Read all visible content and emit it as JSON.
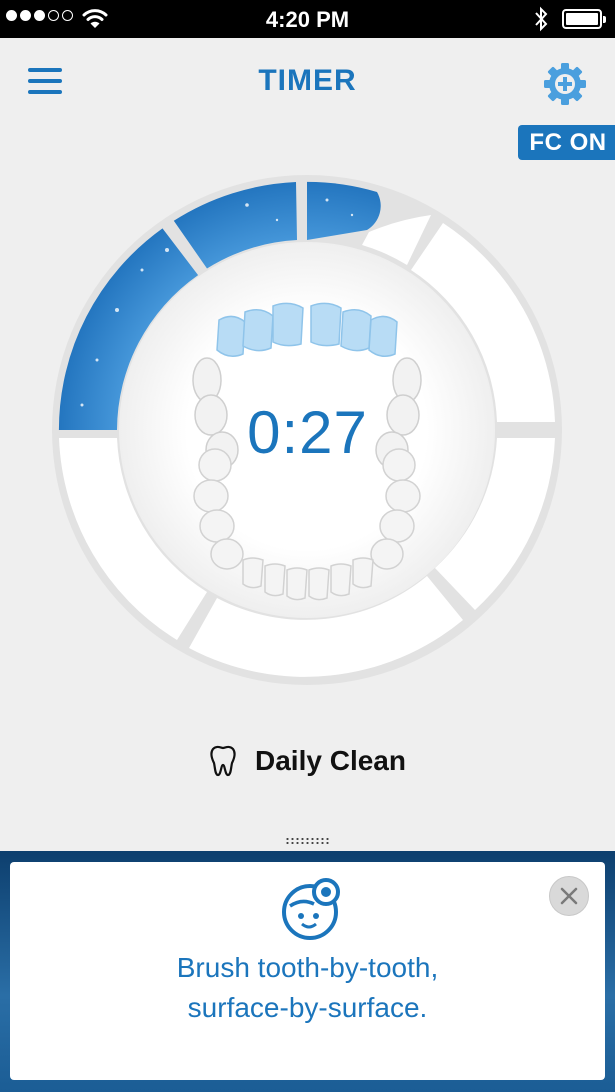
{
  "status_bar": {
    "time": "4:20 PM",
    "signal_bars_filled": 3,
    "signal_bars_total": 5,
    "battery_level": 1.0,
    "icons": [
      "signal-dots-icon",
      "wifi-icon",
      "bluetooth-icon",
      "battery-icon"
    ]
  },
  "header": {
    "title": "TIMER",
    "menu_icon": "hamburger-menu-icon",
    "settings_icon": "gear-plus-icon",
    "badge": "FC ON"
  },
  "timer": {
    "display": "0:27",
    "quadrants": [
      "upper-left",
      "upper-right",
      "lower-right",
      "lower-left"
    ],
    "upper_left_progress": 1.0,
    "upper_right_progress": 0.4,
    "highlighted_teeth": "upper front",
    "accent_color": "#1b75bc",
    "progress_color": "#2a8ad6"
  },
  "mode": {
    "icon": "tooth-icon",
    "label": "Daily Clean"
  },
  "tip": {
    "icon": "brushing-face-icon",
    "text_line1": "Brush tooth-by-tooth,",
    "text_line2": "surface-by-surface.",
    "close_icon": "close-icon"
  },
  "colors": {
    "brand": "#1b75bc",
    "panel": "#1b5d95",
    "background": "#efefef"
  }
}
